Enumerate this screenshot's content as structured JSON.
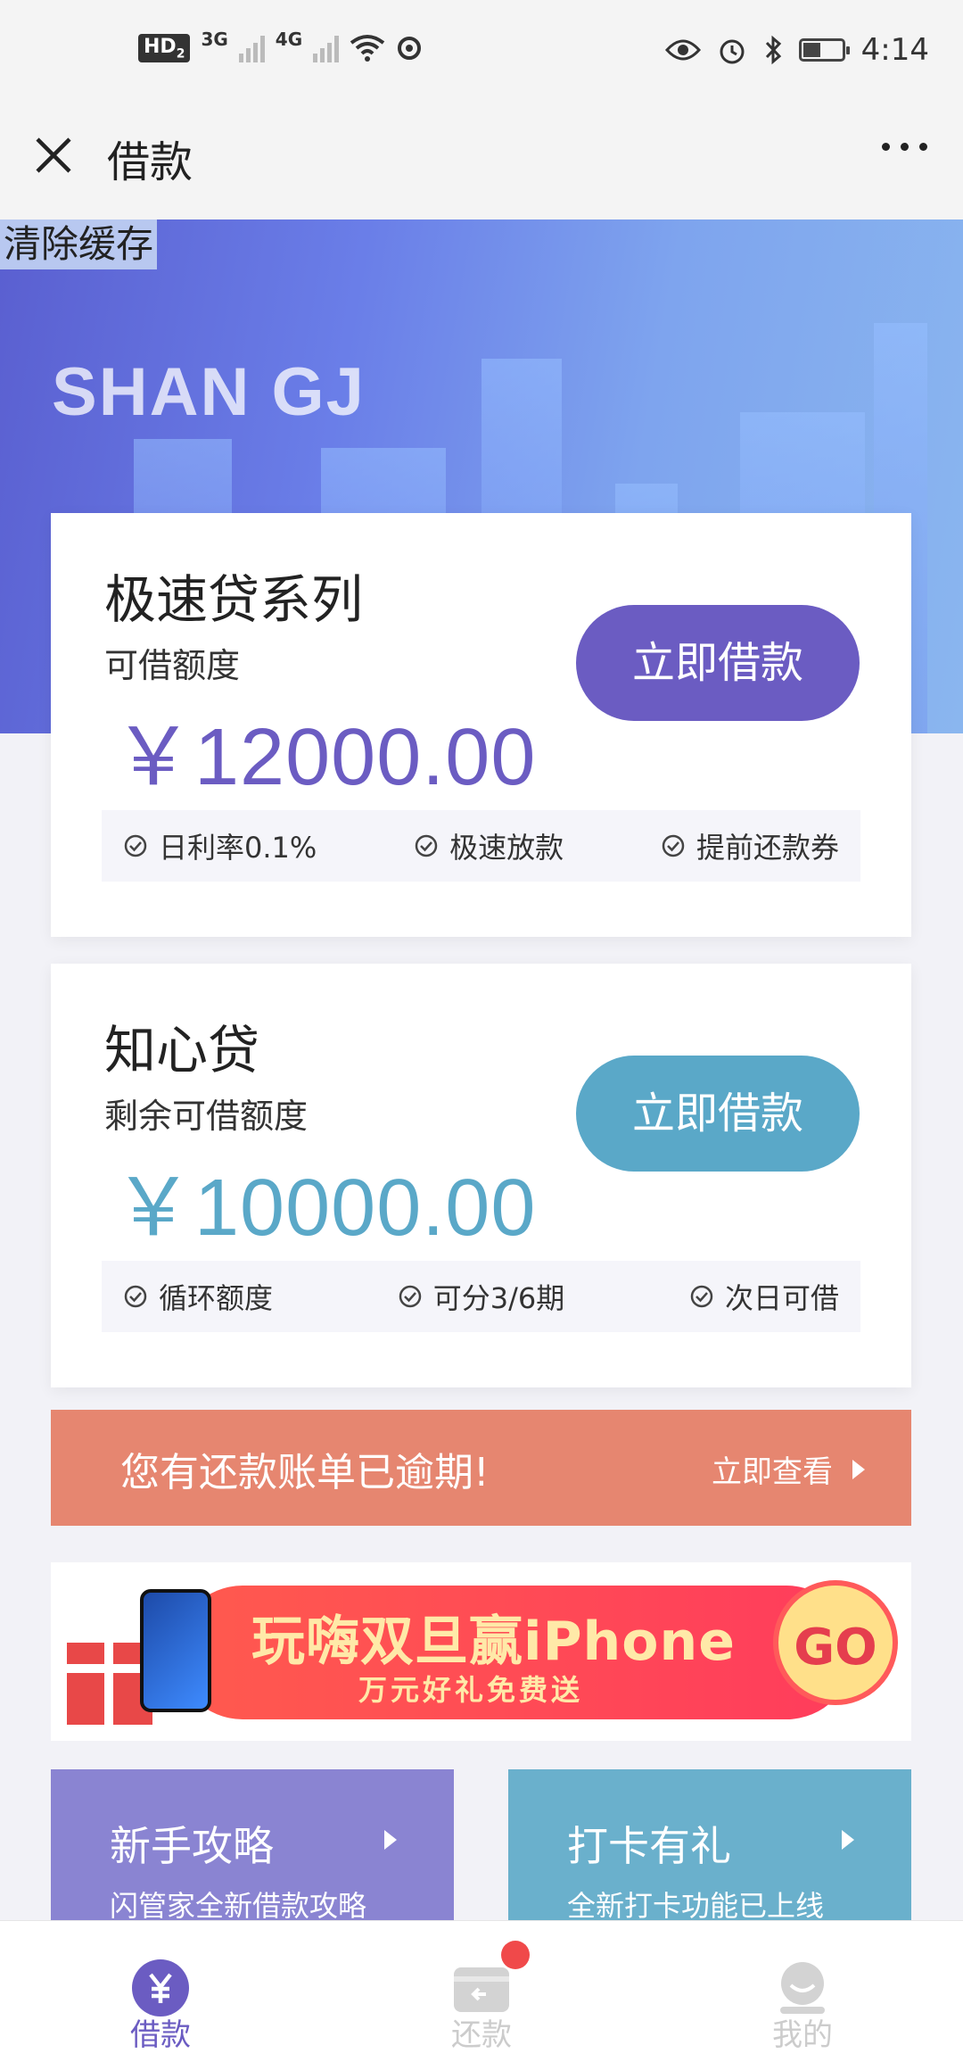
{
  "status_bar": {
    "hd": "HD",
    "hd_sub": "2",
    "net1": "3G",
    "net2": "4G",
    "time": "4:14",
    "battery_level": 0.45
  },
  "title_bar": {
    "title": "借款"
  },
  "banner": {
    "clear_cache": "清除缓存",
    "brand": "SHAN GJ"
  },
  "cards": [
    {
      "title": "极速贷系列",
      "subtitle": "可借额度",
      "amount": "￥12000.00",
      "button": "立即借款",
      "accent": "#6b5cc2",
      "features": [
        "日利率0.1%",
        "极速放款",
        "提前还款券"
      ]
    },
    {
      "title": "知心贷",
      "subtitle": "剩余可借额度",
      "amount": "￥10000.00",
      "button": "立即借款",
      "accent": "#5aa8c8",
      "features": [
        "循环额度",
        "可分3/6期",
        "次日可借"
      ]
    }
  ],
  "overdue": {
    "text": "您有还款账单已逾期!",
    "link": "立即查看"
  },
  "promo": {
    "title": "玩嗨双旦赢iPhone",
    "subtitle": "万元好礼免费送",
    "go": "GO"
  },
  "tiles": [
    {
      "title": "新手攻略",
      "subtitle": "闪管家全新借款攻略",
      "color": "#8a84d2"
    },
    {
      "title": "打卡有礼",
      "subtitle": "全新打卡功能已上线",
      "color": "#6ab0cc"
    }
  ],
  "tabbar": [
    {
      "label": "借款",
      "active": true
    },
    {
      "label": "还款",
      "active": false
    },
    {
      "label": "我的",
      "active": false
    }
  ],
  "colors": {
    "primary": "#6b5cc2",
    "secondary": "#5aa8c8",
    "overdue": "#e68670",
    "inactive": "#cccccc"
  }
}
